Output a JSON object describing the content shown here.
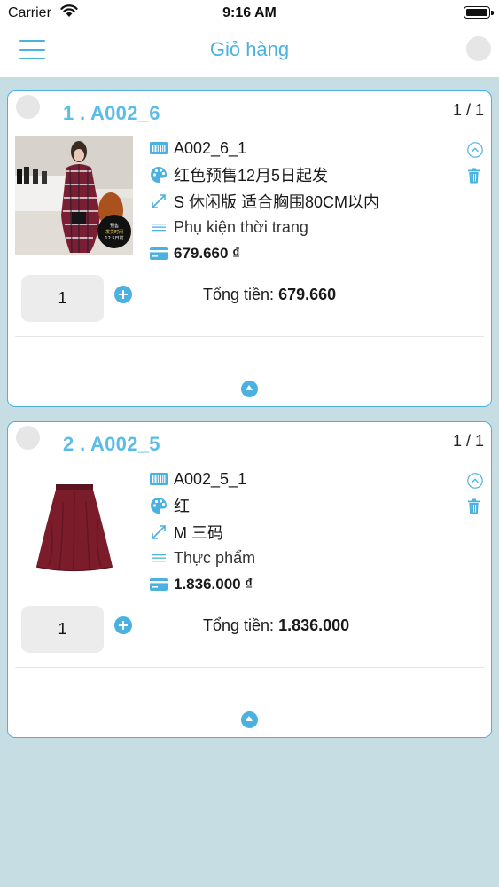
{
  "status_bar": {
    "carrier": "Carrier",
    "time": "9:16 AM"
  },
  "nav": {
    "title": "Giỏ hàng"
  },
  "colors": {
    "accent": "#4ab1e0",
    "background": "#c6dde3",
    "card_border": "#4ab1e0"
  },
  "cart": [
    {
      "title": "1 . A002_6",
      "count": "1 / 1",
      "sku": "A002_6_1",
      "color": "红色预售12月5日起发",
      "size": "S 休闲版 适合胸围80CM以内",
      "category": "Phụ kiện thời trang",
      "price": "679.660 ₫",
      "quantity": "1",
      "total_label": "Tổng tiền: ",
      "total_value": "679.660",
      "image_text": "预售 发货时间 12.5日前"
    },
    {
      "title": "2 . A002_5",
      "count": "1 / 1",
      "sku": "A002_5_1",
      "color": "红",
      "size": "M 三码",
      "category": "Thực phẩm",
      "price": "1.836.000 ₫",
      "quantity": "1",
      "total_label": "Tổng tiền: ",
      "total_value": "1.836.000"
    }
  ]
}
